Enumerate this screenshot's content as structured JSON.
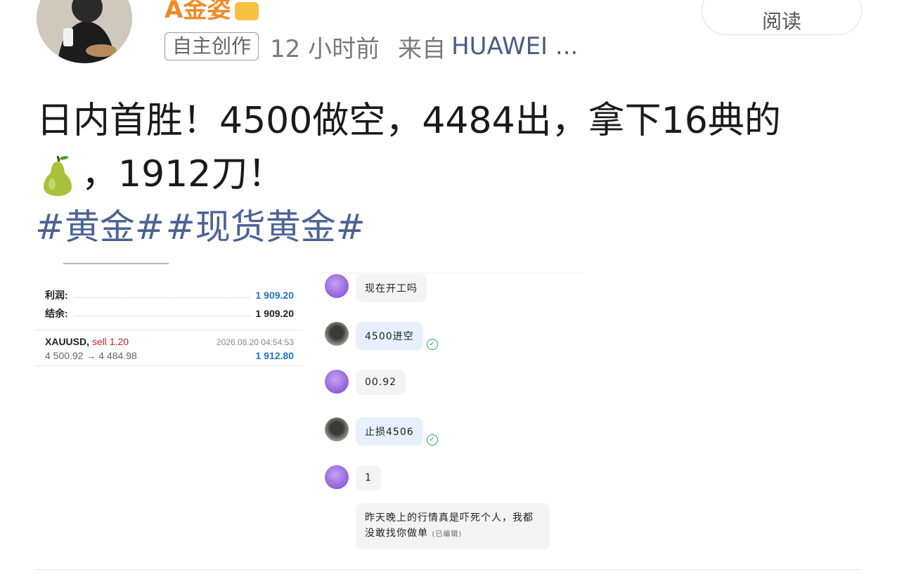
{
  "post": {
    "username": "A金姿",
    "read_label": "阅读",
    "tag": "自主创作",
    "time": "12 小时前",
    "source_prefix": "来自",
    "source_device": "HUAWEI ...",
    "text_line1": "日内首胜！4500做空，4484出，拿下16典的",
    "text_line2": "，1912刀！",
    "hashtags": [
      "#黄金#",
      "#现货黄金#"
    ]
  },
  "trade_screenshot": {
    "profit_label": "利润:",
    "profit_value": "1 909.20",
    "balance_label": "结余:",
    "balance_value": "1 909.20",
    "symbol": "XAUUSD,",
    "direction": "sell 1.20",
    "timestamp": "2026.08.20 04:54:53",
    "prices": "4 500.92 → 4 484.98",
    "trade_profit": "1 912.80"
  },
  "chat": {
    "messages": [
      {
        "text": "现在开工吗"
      },
      {
        "text": "4500进空"
      },
      {
        "text": "00.92"
      },
      {
        "text": "止损4506"
      },
      {
        "text": "1"
      },
      {
        "text": "昨天晚上的行情真是吓死个人，我都没敢找你做单",
        "edited": "(已编辑)"
      }
    ]
  },
  "icons": {
    "pear": "pear-emoji-icon",
    "check": "check-circle-icon"
  },
  "colors": {
    "username": "#f08a24",
    "hashtag": "#4d6396",
    "profit_blue": "#1e74c8",
    "sell_red": "#c8252b",
    "sent_bubble": "#e7f1fd",
    "received_bubble": "#f4f4f4"
  }
}
